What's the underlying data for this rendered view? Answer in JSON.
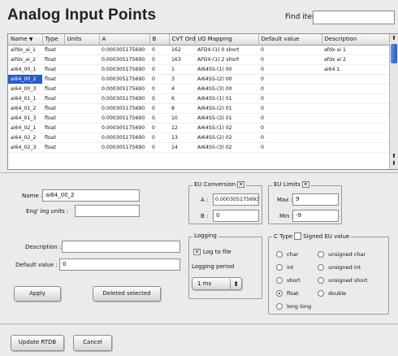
{
  "header": {
    "title": "Analog Input Points",
    "find_label": "Find item :",
    "find_value": ""
  },
  "table": {
    "columns": [
      "Name",
      "Type",
      "Units",
      "A",
      "B",
      "CVT Order",
      "I/O Mapping",
      "Default value",
      "Description"
    ],
    "sort_indicator": "▼",
    "selected_row": 3,
    "rows": [
      [
        "aifdx_ai_1",
        "float",
        "",
        "0.000305175690",
        "0",
        "162",
        "AFDX-(1) 0 short",
        "0",
        "afdx ai 1"
      ],
      [
        "aifdx_ai_2",
        "float",
        "",
        "0.000305175690",
        "0",
        "163",
        "AFDX-(1) 2 short",
        "0",
        "afdx ai 2"
      ],
      [
        "ai64_00_1",
        "float",
        "",
        "0.000305175690",
        "0",
        "1",
        "AI64SS-(1) 00",
        "0",
        "ai64 1"
      ],
      [
        "ai64_00_2",
        "float",
        "",
        "0.000305175690",
        "0",
        "3",
        "AI64SS-(2) 00",
        "0",
        ""
      ],
      [
        "ai64_00_3",
        "float",
        "",
        "0.000305175690",
        "0",
        "4",
        "AI64SS-(3) 00",
        "0",
        ""
      ],
      [
        "ai64_01_1",
        "float",
        "",
        "0.000305175690",
        "0",
        "6",
        "AI64SS-(1) 01",
        "0",
        ""
      ],
      [
        "ai64_01_2",
        "float",
        "",
        "0.000305175690",
        "0",
        "8",
        "AI64SS-(2) 01",
        "0",
        ""
      ],
      [
        "ai64_01_3",
        "float",
        "",
        "0.000305175690",
        "0",
        "10",
        "AI64SS-(3) 01",
        "0",
        ""
      ],
      [
        "ai64_02_1",
        "float",
        "",
        "0.000305175690",
        "0",
        "12",
        "AI64SS-(1) 02",
        "0",
        ""
      ],
      [
        "ai64_02_2",
        "float",
        "",
        "0.000305175690",
        "0",
        "13",
        "AI64SS-(2) 02",
        "0",
        ""
      ],
      [
        "ai64_02_3",
        "float",
        "",
        "0.000305175690",
        "0",
        "14",
        "AI64SS-(3) 02",
        "0",
        ""
      ]
    ]
  },
  "form": {
    "name_label": "Name :",
    "name_value": "ai64_00_2",
    "units_label": "Eng' ing units :",
    "units_value": "",
    "description_label": "Description :",
    "description_value": "",
    "default_label": "Default value :",
    "default_value": "0",
    "apply_label": "Apply",
    "delete_label": "Deleted selected"
  },
  "eu_conversion": {
    "title": "EU Conversion",
    "a_label": "A :",
    "a_value": "0.000305175693",
    "b_label": "B :",
    "b_value": "0"
  },
  "eu_limits": {
    "title": "EU Limits",
    "max_label": "Max :",
    "max_value": "9",
    "min_label": "Min :",
    "min_value": "-9"
  },
  "logging": {
    "title": "Logging",
    "log_to_file_label": "Log to file",
    "log_to_file_checked": true,
    "period_label": "Logging period",
    "period_value": "1 ms"
  },
  "ctype": {
    "title": "C Type",
    "signed_label": "Signed EU value",
    "options": [
      "char",
      "unsigned char",
      "int",
      "unsigned int",
      "short",
      "unsigned short",
      "float",
      "double",
      "long long"
    ],
    "selected": "float"
  },
  "footer": {
    "update_label": "Update RTDB",
    "cancel_label": "Cancel"
  }
}
